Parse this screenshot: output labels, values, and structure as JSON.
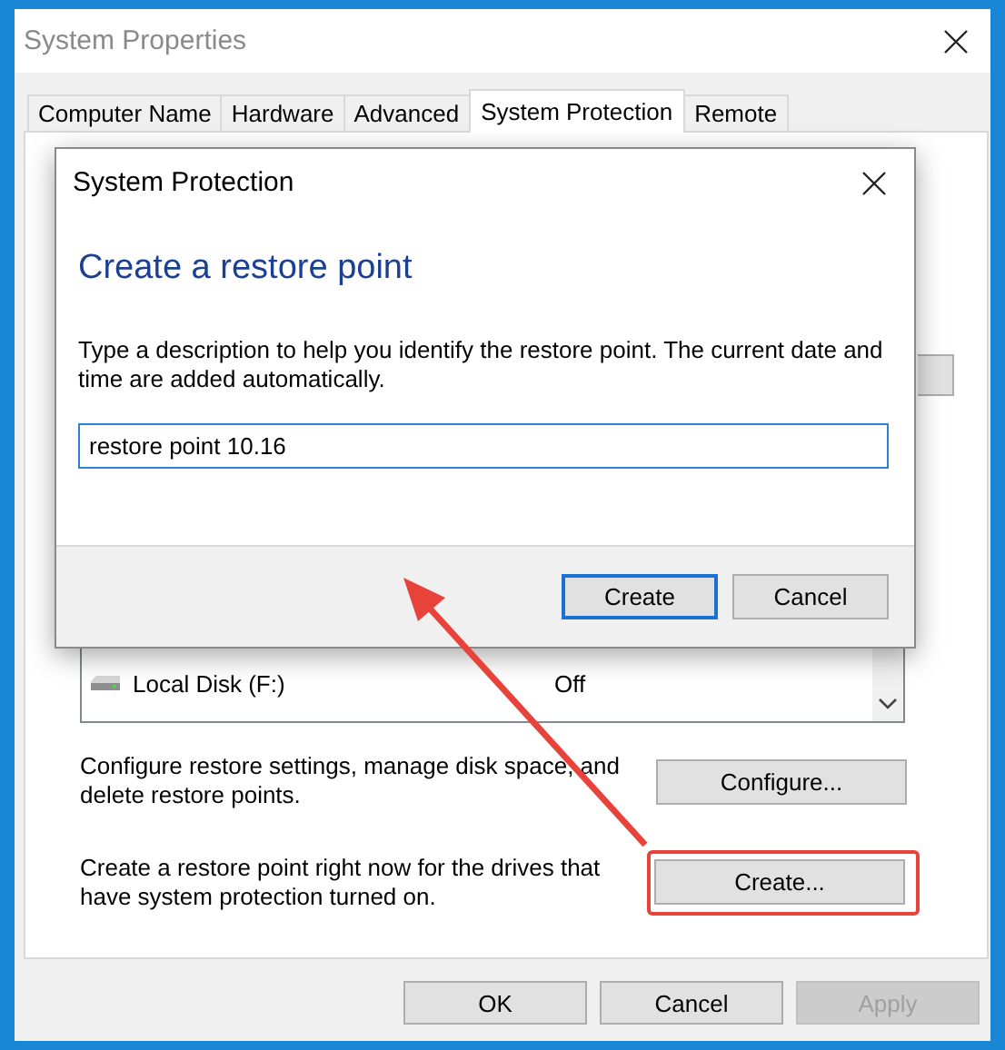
{
  "window": {
    "title": "System Properties"
  },
  "tabs": [
    {
      "label": "Computer Name",
      "selected": false
    },
    {
      "label": "Hardware",
      "selected": false
    },
    {
      "label": "Advanced",
      "selected": false
    },
    {
      "label": "System Protection",
      "selected": true
    },
    {
      "label": "Remote",
      "selected": false
    }
  ],
  "drives": [
    {
      "name": "Local Disk (F:)",
      "protection": "Off"
    }
  ],
  "configure": {
    "text": "Configure restore settings, manage disk space, and delete restore points.",
    "button": "Configure..."
  },
  "create": {
    "text": "Create a restore point right now for the drives that have system protection turned on.",
    "button": "Create...",
    "highlighted": true
  },
  "buttons": [
    {
      "label": "OK",
      "disabled": false
    },
    {
      "label": "Cancel",
      "disabled": false
    },
    {
      "label": "Apply",
      "disabled": true
    }
  ],
  "dialog": {
    "title": "System Protection",
    "heading": "Create a restore point",
    "description": "Type a description to help you identify the restore point. The current date and time are added automatically.",
    "field": {
      "value": "restore point 10.16"
    },
    "buttons": [
      {
        "label": "Create",
        "default": true
      },
      {
        "label": "Cancel",
        "default": false
      }
    ]
  }
}
